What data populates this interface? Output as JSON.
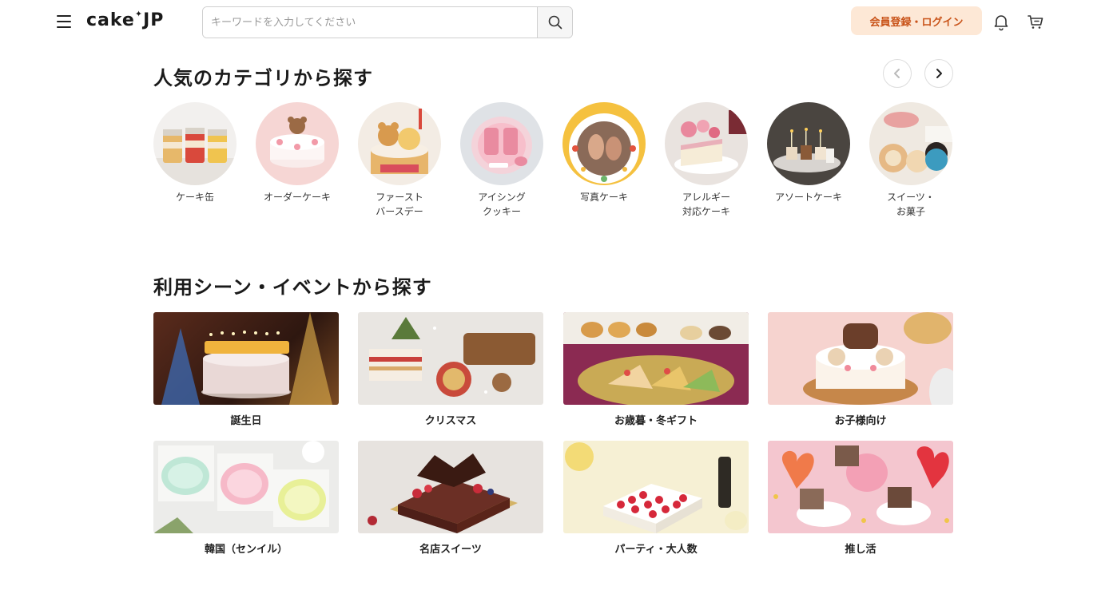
{
  "header": {
    "logo": "cake",
    "logo_suffix": "JP",
    "search_placeholder": "キーワードを入力してください",
    "login_label": "会員登録・ログイン"
  },
  "icons": {
    "menu": "hamburger-icon",
    "search": "search-icon",
    "bell": "bell-icon",
    "cart": "cart-icon",
    "prev": "chevron-left-icon",
    "next": "chevron-right-icon"
  },
  "colors": {
    "accent": "#c9541a",
    "login_bg": "#fde8d6"
  },
  "categories": {
    "title": "人気のカテゴリから探す",
    "items": [
      {
        "label": "ケーキ缶"
      },
      {
        "label": "オーダーケーキ"
      },
      {
        "label": "ファースト\nバースデー"
      },
      {
        "label": "アイシング\nクッキー"
      },
      {
        "label": "写真ケーキ"
      },
      {
        "label": "アレルギー\n対応ケーキ"
      },
      {
        "label": "アソートケーキ"
      },
      {
        "label": "スイーツ・\nお菓子"
      }
    ]
  },
  "scenes": {
    "title": "利用シーン・イベントから探す",
    "items": [
      {
        "label": "誕生日"
      },
      {
        "label": "クリスマス"
      },
      {
        "label": "お歳暮・冬ギフト"
      },
      {
        "label": "お子様向け"
      },
      {
        "label": "韓国（センイル）"
      },
      {
        "label": "名店スイーツ"
      },
      {
        "label": "パーティ・大人数"
      },
      {
        "label": "推し活"
      }
    ]
  }
}
